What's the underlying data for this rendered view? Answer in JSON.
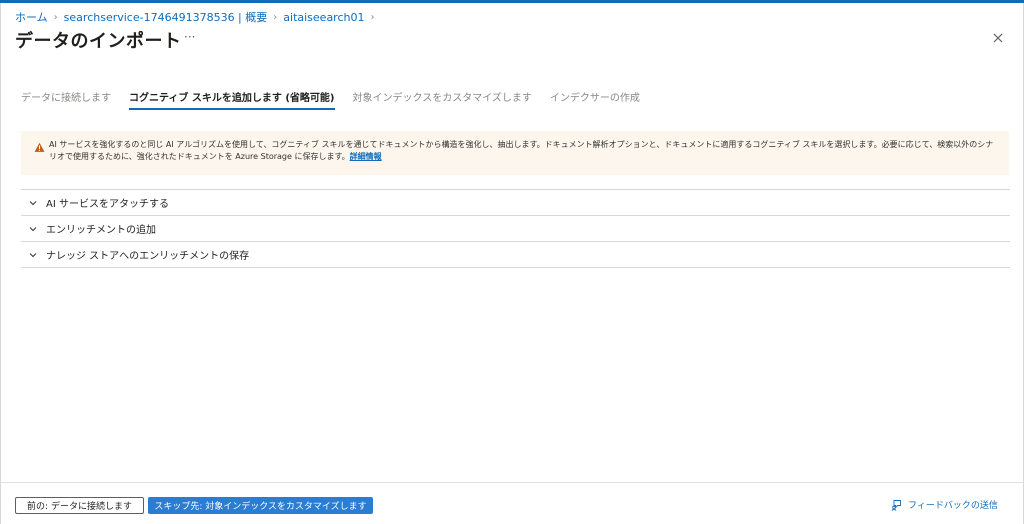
{
  "breadcrumb": {
    "items": [
      "ホーム",
      "searchservice-1746491378536 | 概要",
      "aitaiseearch01"
    ]
  },
  "header": {
    "title": "データのインポート",
    "more_label": "···"
  },
  "tabs": [
    {
      "label": "データに接続します",
      "active": false
    },
    {
      "label": "コグニティブ スキルを追加します (省略可能)",
      "active": true
    },
    {
      "label": "対象インデックスをカスタマイズします",
      "active": false
    },
    {
      "label": "インデクサーの作成",
      "active": false
    }
  ],
  "banner": {
    "text": "AI サービスを強化するのと同じ AI アルゴリズムを使用して、コグニティブ スキルを通じてドキュメントから構造を強化し、抽出します。ドキュメント解析オプションと、ドキュメントに適用するコグニティブ スキルを選択します。必要に応じて、検索以外のシナリオで使用するために、強化されたドキュメントを Azure Storage に保存します。",
    "link": "詳細情報",
    "icon": "warning-icon",
    "color": "#fdf6ec"
  },
  "sections": [
    {
      "label": "AI サービスをアタッチする"
    },
    {
      "label": "エンリッチメントの追加"
    },
    {
      "label": "ナレッジ ストアへのエンリッチメントの保存"
    }
  ],
  "footer": {
    "prev_label": "前の: データに接続します",
    "skip_label": "スキップ先: 対象インデックスをカスタマイズします",
    "feedback_label": "フィードバックの送信"
  },
  "colors": {
    "accent": "#0f6cbd",
    "primary_button": "#2b7cd3",
    "warning": "#c05b1a"
  }
}
